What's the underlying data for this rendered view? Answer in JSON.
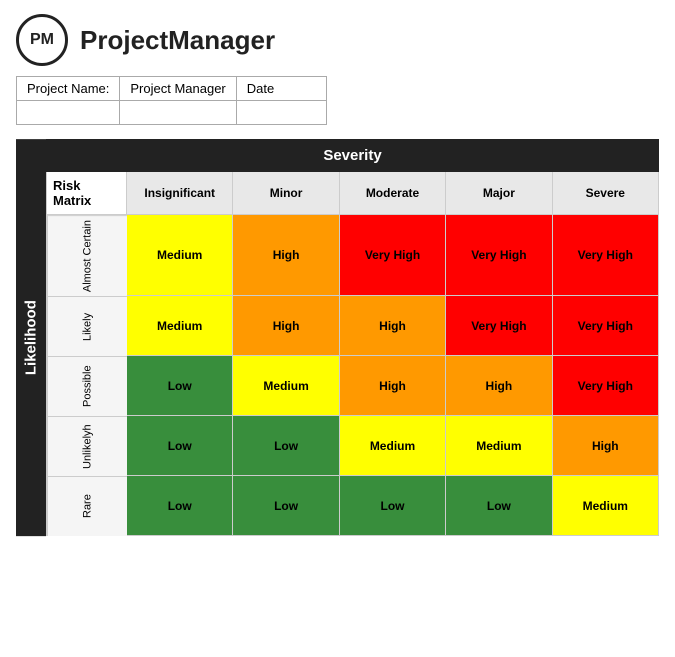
{
  "header": {
    "logo_text": "PM",
    "app_title": "ProjectManager"
  },
  "info_fields": [
    {
      "label": "Project Name:",
      "value": ""
    },
    {
      "label": "Project Manager",
      "value": ""
    },
    {
      "label": "Date",
      "value": ""
    }
  ],
  "matrix": {
    "likelihood_label": "Likelihood",
    "severity_label": "Severity",
    "risk_matrix_label": "Risk Matrix",
    "col_headers": [
      "Insignificant",
      "Minor",
      "Moderate",
      "Major",
      "Severe"
    ],
    "rows": [
      {
        "label": "Almost Certain",
        "cells": [
          {
            "text": "Medium",
            "class": "medium"
          },
          {
            "text": "High",
            "class": "high"
          },
          {
            "text": "Very High",
            "class": "very-high"
          },
          {
            "text": "Very High",
            "class": "very-high"
          },
          {
            "text": "Very High",
            "class": "very-high"
          }
        ]
      },
      {
        "label": "Likely",
        "cells": [
          {
            "text": "Medium",
            "class": "medium"
          },
          {
            "text": "High",
            "class": "high"
          },
          {
            "text": "High",
            "class": "high"
          },
          {
            "text": "Very High",
            "class": "very-high"
          },
          {
            "text": "Very High",
            "class": "very-high"
          }
        ]
      },
      {
        "label": "Possible",
        "cells": [
          {
            "text": "Low",
            "class": "low-dark"
          },
          {
            "text": "Medium",
            "class": "medium"
          },
          {
            "text": "High",
            "class": "high"
          },
          {
            "text": "High",
            "class": "high"
          },
          {
            "text": "Very High",
            "class": "very-high"
          }
        ]
      },
      {
        "label": "Unlikelyh",
        "cells": [
          {
            "text": "Low",
            "class": "low-dark"
          },
          {
            "text": "Low",
            "class": "low-dark"
          },
          {
            "text": "Medium",
            "class": "medium"
          },
          {
            "text": "Medium",
            "class": "medium"
          },
          {
            "text": "High",
            "class": "high"
          }
        ]
      },
      {
        "label": "Rare",
        "cells": [
          {
            "text": "Low",
            "class": "low-dark"
          },
          {
            "text": "Low",
            "class": "low-dark"
          },
          {
            "text": "Low",
            "class": "low-dark"
          },
          {
            "text": "Low",
            "class": "low-dark"
          },
          {
            "text": "Medium",
            "class": "medium"
          }
        ]
      }
    ]
  }
}
